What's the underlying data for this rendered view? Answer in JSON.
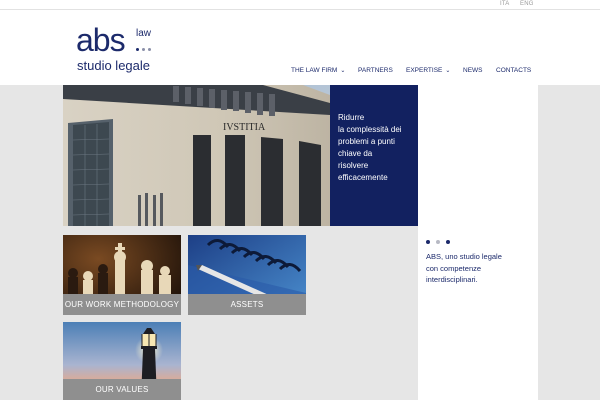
{
  "topbar": {
    "lang_ita": "ITA",
    "lang_eng": "ENG"
  },
  "logo": {
    "abs": "abs",
    "law": "law",
    "sub": "studio legale"
  },
  "nav": [
    {
      "label": "THE LAW FIRM",
      "dropdown": true
    },
    {
      "label": "PARTNERS",
      "dropdown": false
    },
    {
      "label": "EXPERTISE",
      "dropdown": true
    },
    {
      "label": "NEWS",
      "dropdown": false
    },
    {
      "label": "CONTACTS",
      "dropdown": false
    }
  ],
  "hero": {
    "building_inscription": "IVSTITIA",
    "text_lines": [
      "Ridurre",
      "la complessità dei",
      "problemi a punti",
      "chiave da",
      "risolvere",
      "efficacemente"
    ]
  },
  "carousel": {
    "slides": 3,
    "active": 0
  },
  "intro": {
    "lines": [
      "ABS, uno studio legale",
      "con competenze",
      "interdisciplinari."
    ]
  },
  "tiles": [
    {
      "label": "OUR WORK METHODOLOGY"
    },
    {
      "label": "ASSETS"
    },
    {
      "label": "OUR VALUES"
    }
  ],
  "colors": {
    "navy": "#122160",
    "logo": "#1c2a6b",
    "tile_label": "#8f8f8f",
    "background": "#e6e6e6"
  }
}
